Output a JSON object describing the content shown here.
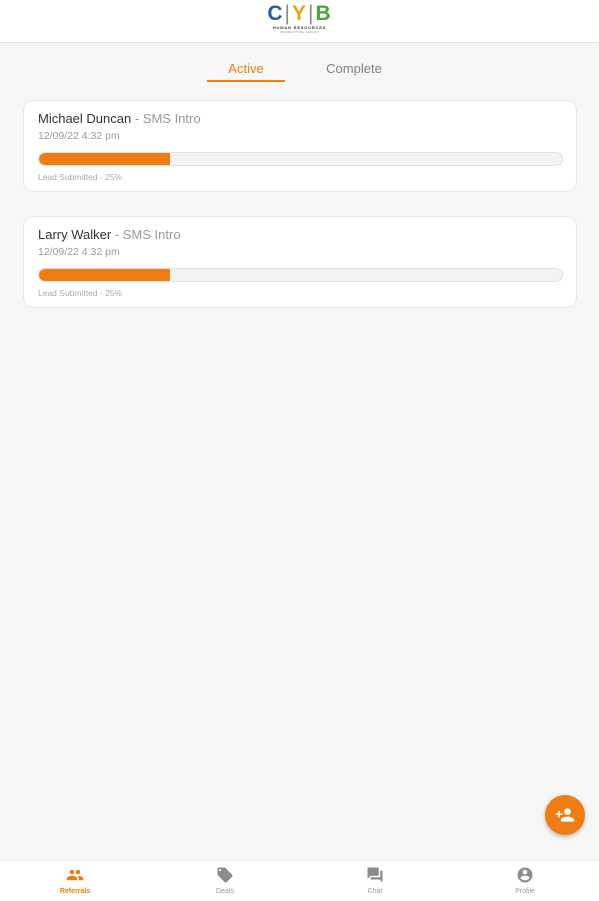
{
  "header": {
    "logo": {
      "letters": [
        "C",
        "Y",
        "B"
      ],
      "separator": "|",
      "subtitle": "HUMAN RESOURCES",
      "tagline": "CONSULTING GROUP"
    }
  },
  "tabs": [
    {
      "label": "Active",
      "selected": true
    },
    {
      "label": "Complete",
      "selected": false
    }
  ],
  "referrals": [
    {
      "name": "Michael Duncan",
      "separator": " - ",
      "source": "SMS Intro",
      "date": "12/09/22 4:32 pm",
      "progress_percent": 25,
      "status": "Lead Submitted - 25%"
    },
    {
      "name": "Larry Walker",
      "separator": " - ",
      "source": "SMS Intro",
      "date": "12/09/22 4:32 pm",
      "progress_percent": 25,
      "status": "Lead Submitted - 25%"
    }
  ],
  "fab": {
    "icon": "add-person-icon"
  },
  "bottom_nav": [
    {
      "label": "Referrals",
      "icon": "people-icon",
      "active": true
    },
    {
      "label": "Deals",
      "icon": "tag-icon",
      "active": false
    },
    {
      "label": "Chat",
      "icon": "chat-icon",
      "active": false
    },
    {
      "label": "Profile",
      "icon": "account-circle-icon",
      "active": false
    }
  ],
  "colors": {
    "accent": "#f07c14",
    "logo_c": "#1f5ea8",
    "logo_y": "#e8a21a",
    "logo_b": "#4aa43a",
    "background": "#f7f7f7"
  }
}
